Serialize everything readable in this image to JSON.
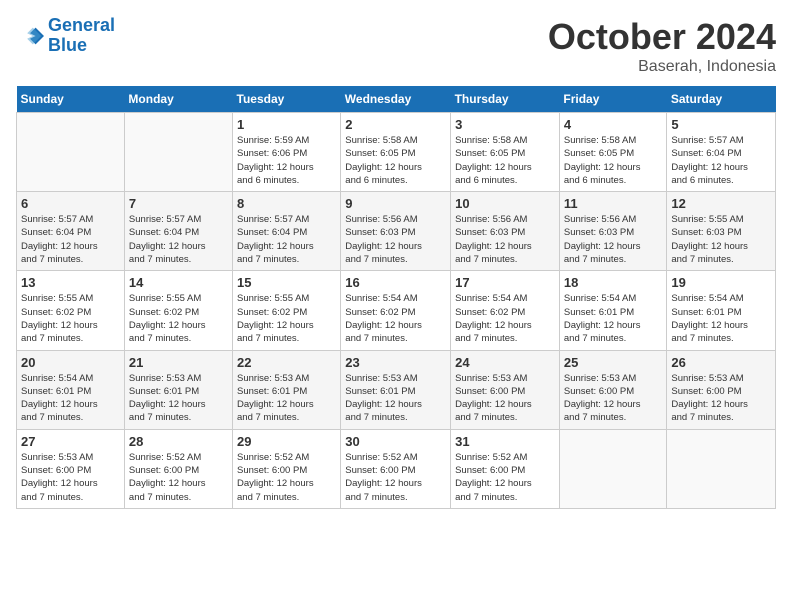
{
  "logo": {
    "line1": "General",
    "line2": "Blue"
  },
  "title": "October 2024",
  "subtitle": "Baserah, Indonesia",
  "days_header": [
    "Sunday",
    "Monday",
    "Tuesday",
    "Wednesday",
    "Thursday",
    "Friday",
    "Saturday"
  ],
  "weeks": [
    [
      {
        "day": "",
        "detail": ""
      },
      {
        "day": "",
        "detail": ""
      },
      {
        "day": "1",
        "detail": "Sunrise: 5:59 AM\nSunset: 6:06 PM\nDaylight: 12 hours\nand 6 minutes."
      },
      {
        "day": "2",
        "detail": "Sunrise: 5:58 AM\nSunset: 6:05 PM\nDaylight: 12 hours\nand 6 minutes."
      },
      {
        "day": "3",
        "detail": "Sunrise: 5:58 AM\nSunset: 6:05 PM\nDaylight: 12 hours\nand 6 minutes."
      },
      {
        "day": "4",
        "detail": "Sunrise: 5:58 AM\nSunset: 6:05 PM\nDaylight: 12 hours\nand 6 minutes."
      },
      {
        "day": "5",
        "detail": "Sunrise: 5:57 AM\nSunset: 6:04 PM\nDaylight: 12 hours\nand 6 minutes."
      }
    ],
    [
      {
        "day": "6",
        "detail": "Sunrise: 5:57 AM\nSunset: 6:04 PM\nDaylight: 12 hours\nand 7 minutes."
      },
      {
        "day": "7",
        "detail": "Sunrise: 5:57 AM\nSunset: 6:04 PM\nDaylight: 12 hours\nand 7 minutes."
      },
      {
        "day": "8",
        "detail": "Sunrise: 5:57 AM\nSunset: 6:04 PM\nDaylight: 12 hours\nand 7 minutes."
      },
      {
        "day": "9",
        "detail": "Sunrise: 5:56 AM\nSunset: 6:03 PM\nDaylight: 12 hours\nand 7 minutes."
      },
      {
        "day": "10",
        "detail": "Sunrise: 5:56 AM\nSunset: 6:03 PM\nDaylight: 12 hours\nand 7 minutes."
      },
      {
        "day": "11",
        "detail": "Sunrise: 5:56 AM\nSunset: 6:03 PM\nDaylight: 12 hours\nand 7 minutes."
      },
      {
        "day": "12",
        "detail": "Sunrise: 5:55 AM\nSunset: 6:03 PM\nDaylight: 12 hours\nand 7 minutes."
      }
    ],
    [
      {
        "day": "13",
        "detail": "Sunrise: 5:55 AM\nSunset: 6:02 PM\nDaylight: 12 hours\nand 7 minutes."
      },
      {
        "day": "14",
        "detail": "Sunrise: 5:55 AM\nSunset: 6:02 PM\nDaylight: 12 hours\nand 7 minutes."
      },
      {
        "day": "15",
        "detail": "Sunrise: 5:55 AM\nSunset: 6:02 PM\nDaylight: 12 hours\nand 7 minutes."
      },
      {
        "day": "16",
        "detail": "Sunrise: 5:54 AM\nSunset: 6:02 PM\nDaylight: 12 hours\nand 7 minutes."
      },
      {
        "day": "17",
        "detail": "Sunrise: 5:54 AM\nSunset: 6:02 PM\nDaylight: 12 hours\nand 7 minutes."
      },
      {
        "day": "18",
        "detail": "Sunrise: 5:54 AM\nSunset: 6:01 PM\nDaylight: 12 hours\nand 7 minutes."
      },
      {
        "day": "19",
        "detail": "Sunrise: 5:54 AM\nSunset: 6:01 PM\nDaylight: 12 hours\nand 7 minutes."
      }
    ],
    [
      {
        "day": "20",
        "detail": "Sunrise: 5:54 AM\nSunset: 6:01 PM\nDaylight: 12 hours\nand 7 minutes."
      },
      {
        "day": "21",
        "detail": "Sunrise: 5:53 AM\nSunset: 6:01 PM\nDaylight: 12 hours\nand 7 minutes."
      },
      {
        "day": "22",
        "detail": "Sunrise: 5:53 AM\nSunset: 6:01 PM\nDaylight: 12 hours\nand 7 minutes."
      },
      {
        "day": "23",
        "detail": "Sunrise: 5:53 AM\nSunset: 6:01 PM\nDaylight: 12 hours\nand 7 minutes."
      },
      {
        "day": "24",
        "detail": "Sunrise: 5:53 AM\nSunset: 6:00 PM\nDaylight: 12 hours\nand 7 minutes."
      },
      {
        "day": "25",
        "detail": "Sunrise: 5:53 AM\nSunset: 6:00 PM\nDaylight: 12 hours\nand 7 minutes."
      },
      {
        "day": "26",
        "detail": "Sunrise: 5:53 AM\nSunset: 6:00 PM\nDaylight: 12 hours\nand 7 minutes."
      }
    ],
    [
      {
        "day": "27",
        "detail": "Sunrise: 5:53 AM\nSunset: 6:00 PM\nDaylight: 12 hours\nand 7 minutes."
      },
      {
        "day": "28",
        "detail": "Sunrise: 5:52 AM\nSunset: 6:00 PM\nDaylight: 12 hours\nand 7 minutes."
      },
      {
        "day": "29",
        "detail": "Sunrise: 5:52 AM\nSunset: 6:00 PM\nDaylight: 12 hours\nand 7 minutes."
      },
      {
        "day": "30",
        "detail": "Sunrise: 5:52 AM\nSunset: 6:00 PM\nDaylight: 12 hours\nand 7 minutes."
      },
      {
        "day": "31",
        "detail": "Sunrise: 5:52 AM\nSunset: 6:00 PM\nDaylight: 12 hours\nand 7 minutes."
      },
      {
        "day": "",
        "detail": ""
      },
      {
        "day": "",
        "detail": ""
      }
    ]
  ]
}
